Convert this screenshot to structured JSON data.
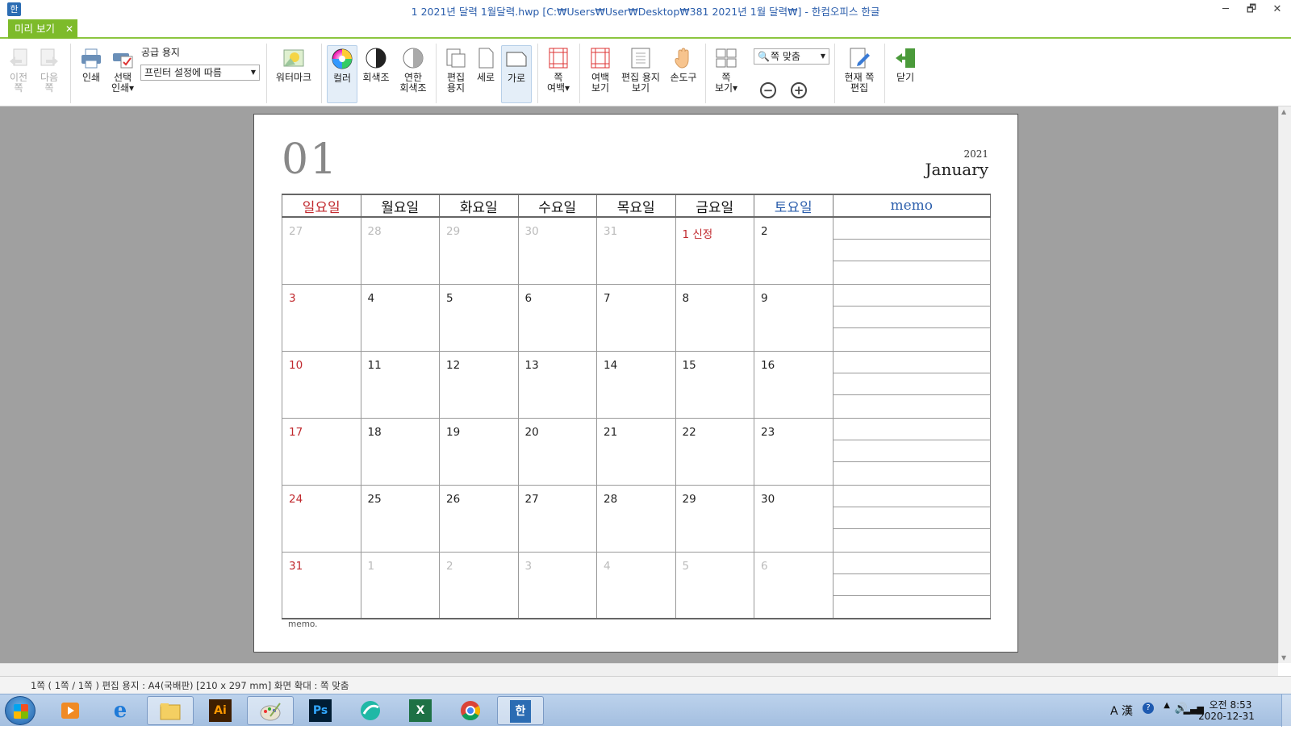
{
  "window": {
    "title": "1 2021년 달력 1월달력.hwp [C:₩Users₩User₩Desktop₩381 2021년 1월 달력₩] - 한컴오피스 한글",
    "minimize": "─",
    "restore": "🗗",
    "close": "✕"
  },
  "tab": {
    "label": "미리 보기",
    "close": "✕"
  },
  "toolbar": {
    "prev_page": "이전\n쪽",
    "next_page": "다음\n쪽",
    "print": "인쇄",
    "select_print": "선택\n인쇄▾",
    "paper_label": "공급 용지",
    "paper_value": "프린터 설정에 따름",
    "watermark": "워터마크",
    "color": "컬러",
    "grayscale": "회색조",
    "light_grayscale": "연한\n회색조",
    "edit_paper": "편집\n용지",
    "portrait": "세로",
    "landscape": "가로",
    "page_margin": "쪽\n여백▾",
    "margin_view": "여백\n보기",
    "edit_paper_view": "편집 용지\n보기",
    "hand_tool": "손도구",
    "page_view": "쪽\n보기▾",
    "zoom_value": "쪽 맞춤",
    "zoom_out": "−",
    "zoom_in": "+",
    "edit_current_page": "현재 쪽\n편집",
    "close": "닫기"
  },
  "calendar": {
    "month_number": "01",
    "year": "2021",
    "month_name": "January",
    "headers": [
      "일요일",
      "월요일",
      "화요일",
      "수요일",
      "목요일",
      "금요일",
      "토요일",
      "memo"
    ],
    "weeks": [
      [
        "27",
        "28",
        "29",
        "30",
        "31",
        "1 신정",
        "2"
      ],
      [
        "3",
        "4",
        "5",
        "6",
        "7",
        "8",
        "9"
      ],
      [
        "10",
        "11",
        "12",
        "13",
        "14",
        "15",
        "16"
      ],
      [
        "17",
        "18",
        "19",
        "20",
        "21",
        "22",
        "23"
      ],
      [
        "24",
        "25",
        "26",
        "27",
        "28",
        "29",
        "30"
      ],
      [
        "31",
        "1",
        "2",
        "3",
        "4",
        "5",
        "6"
      ]
    ],
    "footer_memo": "memo."
  },
  "status": {
    "text": "1쪽 ( 1쪽 / 1쪽 ) 편집 용지 : A4(국배판) [210 x 297 mm] 화면 확대 : 쪽 맞춤"
  },
  "taskbar": {
    "apps": [
      "media-player",
      "internet-explorer",
      "file-explorer",
      "illustrator",
      "paint",
      "photoshop",
      "messenger",
      "excel",
      "chrome",
      "hancom-hwp"
    ],
    "ime": "A 漢",
    "time": "오전 8:53",
    "date": "2020-12-31"
  },
  "colors": {
    "accent_green": "#7dbb2a",
    "sunday_red": "#c0282d",
    "saturday_blue": "#2a5dab"
  }
}
